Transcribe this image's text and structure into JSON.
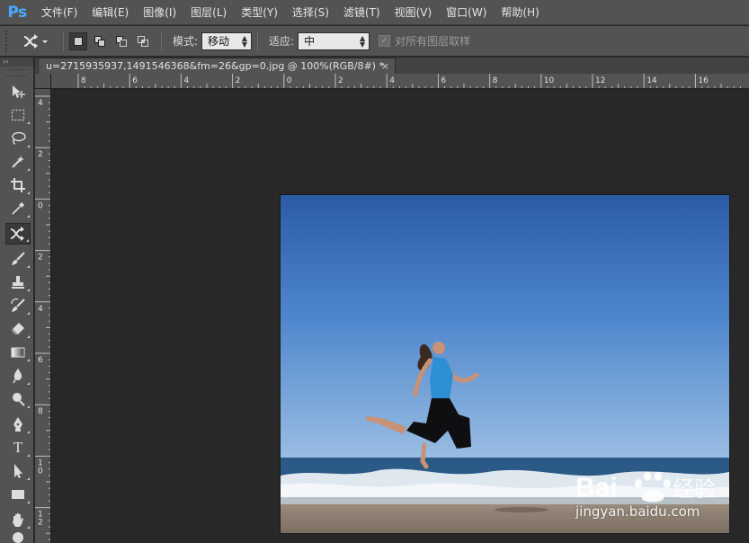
{
  "app": {
    "logo": "Ps",
    "brand_color": "#4aa9ff"
  },
  "menu": [
    {
      "label": "文件(F)"
    },
    {
      "label": "编辑(E)"
    },
    {
      "label": "图像(I)"
    },
    {
      "label": "图层(L)"
    },
    {
      "label": "类型(Y)"
    },
    {
      "label": "选择(S)"
    },
    {
      "label": "滤镜(T)"
    },
    {
      "label": "视图(V)"
    },
    {
      "label": "窗口(W)"
    },
    {
      "label": "帮助(H)"
    }
  ],
  "options": {
    "tool_preset_icon": "content-aware-move-icon",
    "selection_modes": [
      "new-selection-icon",
      "add-to-selection-icon",
      "subtract-from-selection-icon",
      "intersect-selection-icon"
    ],
    "mode_label": "模式:",
    "mode_value": "移动",
    "adapt_label": "适应:",
    "adapt_value": "中",
    "sample_all_layers_label": "对所有图层取样",
    "sample_all_layers_checked": true
  },
  "tools": [
    {
      "name": "move-tool",
      "icon": "move-icon"
    },
    {
      "name": "marquee-tool",
      "icon": "marquee-icon"
    },
    {
      "name": "lasso-tool",
      "icon": "lasso-icon"
    },
    {
      "name": "magic-wand-tool",
      "icon": "magic-wand-icon"
    },
    {
      "name": "crop-tool",
      "icon": "crop-icon"
    },
    {
      "name": "eyedropper-tool",
      "icon": "eyedropper-icon"
    },
    {
      "name": "content-aware-move-tool",
      "icon": "content-aware-move-icon",
      "active": true
    },
    {
      "name": "brush-tool",
      "icon": "brush-icon"
    },
    {
      "name": "clone-stamp-tool",
      "icon": "stamp-icon"
    },
    {
      "name": "history-brush-tool",
      "icon": "history-brush-icon"
    },
    {
      "name": "eraser-tool",
      "icon": "eraser-icon"
    },
    {
      "name": "gradient-tool",
      "icon": "gradient-icon"
    },
    {
      "name": "blur-tool",
      "icon": "blur-icon"
    },
    {
      "name": "dodge-tool",
      "icon": "dodge-icon"
    },
    {
      "name": "pen-tool",
      "icon": "pen-icon"
    },
    {
      "name": "type-tool",
      "icon": "type-icon",
      "glyph": "T"
    },
    {
      "name": "path-selection-tool",
      "icon": "path-selection-icon"
    },
    {
      "name": "rectangle-tool",
      "icon": "rectangle-icon"
    },
    {
      "name": "hand-tool",
      "icon": "hand-icon"
    },
    {
      "name": "zoom-tool",
      "icon": "zoom-icon"
    }
  ],
  "document": {
    "tab_title": "u=2715935937,1491546368&fm=26&gp=0.jpg @ 100%(RGB/8#) *",
    "close_glyph": "×"
  },
  "rulers": {
    "horizontal_labels": [
      "8",
      "6",
      "4",
      "2",
      "0",
      "2",
      "4",
      "6",
      "8",
      "10",
      "12",
      "14",
      "16"
    ],
    "vertical_labels": [
      "4",
      "2",
      "0",
      "2",
      "4",
      "6",
      "8",
      "10",
      "12"
    ]
  },
  "watermark": {
    "text": "jingyan.baidu.com",
    "logo_text": "Bai",
    "logo_cn": "经验"
  },
  "colors": {
    "ui_panel": "#535353",
    "canvas_bg": "#282828",
    "sky_top": "#2f5fa8",
    "sky_bottom": "#8fb5df",
    "sea": "#2a5a86",
    "sand": "#8a7d70"
  }
}
